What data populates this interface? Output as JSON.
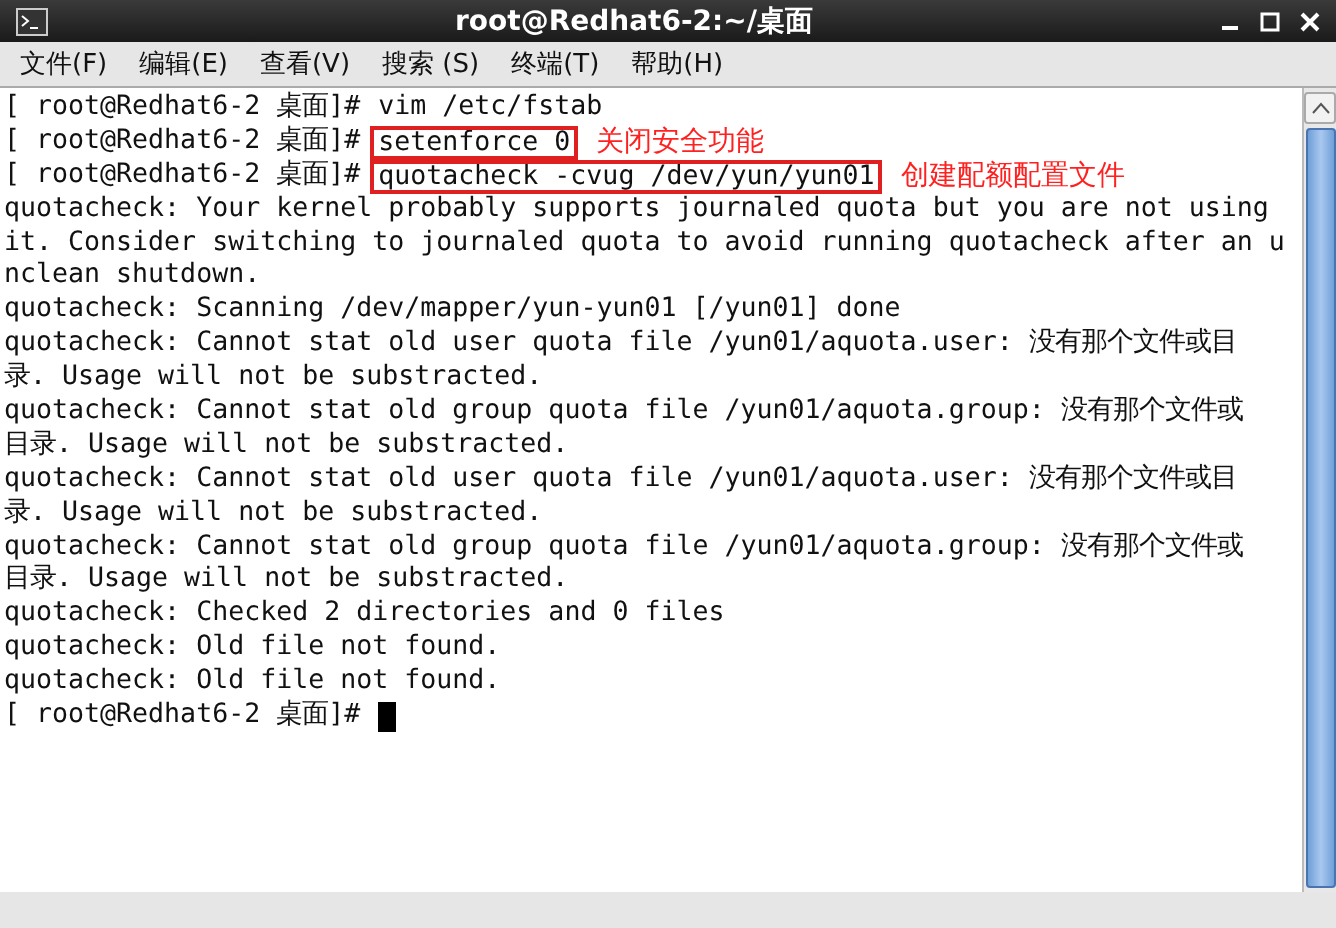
{
  "window": {
    "title": "root@Redhat6-2:~/桌面"
  },
  "menu": [
    {
      "label": "文件(F)"
    },
    {
      "label": "编辑(E)"
    },
    {
      "label": "查看(V)"
    },
    {
      "label": "搜索 (S)"
    },
    {
      "label": "终端(T)"
    },
    {
      "label": "帮助(H)"
    }
  ],
  "terminal": {
    "lines": [
      {
        "kind": "prompt",
        "prompt": "[ root@Redhat6-2 桌面]#",
        "command": "vim /etc/fstab"
      },
      {
        "kind": "prompt",
        "prompt": "[ root@Redhat6-2 桌面]#",
        "command": "setenforce 0",
        "highlighted": true,
        "annotation": "关闭安全功能"
      },
      {
        "kind": "prompt",
        "prompt": "[ root@Redhat6-2 桌面]#",
        "command": "quotacheck -cvug /dev/yun/yun01",
        "highlighted": true,
        "annotation": "创建配额配置文件"
      },
      {
        "kind": "output",
        "text": "quotacheck: Your kernel probably supports journaled quota but you are not using"
      },
      {
        "kind": "output",
        "text": "it. Consider switching to journaled quota to avoid running quotacheck after an u"
      },
      {
        "kind": "output",
        "text": "nclean shutdown."
      },
      {
        "kind": "output",
        "text": "quotacheck: Scanning /dev/mapper/yun-yun01 [/yun01] done"
      },
      {
        "kind": "output",
        "text": "quotacheck: Cannot stat old user quota file /yun01/aquota.user: 没有那个文件或目"
      },
      {
        "kind": "output",
        "text": "录. Usage will not be substracted."
      },
      {
        "kind": "output",
        "text": "quotacheck: Cannot stat old group quota file /yun01/aquota.group: 没有那个文件或"
      },
      {
        "kind": "output",
        "text": "目录. Usage will not be substracted."
      },
      {
        "kind": "output",
        "text": "quotacheck: Cannot stat old user quota file /yun01/aquota.user: 没有那个文件或目"
      },
      {
        "kind": "output",
        "text": "录. Usage will not be substracted."
      },
      {
        "kind": "output",
        "text": "quotacheck: Cannot stat old group quota file /yun01/aquota.group: 没有那个文件或"
      },
      {
        "kind": "output",
        "text": "目录. Usage will not be substracted."
      },
      {
        "kind": "output",
        "text": "quotacheck: Checked 2 directories and 0 files"
      },
      {
        "kind": "output",
        "text": "quotacheck: Old file not found."
      },
      {
        "kind": "output",
        "text": "quotacheck: Old file not found."
      },
      {
        "kind": "prompt",
        "prompt": "[ root@Redhat6-2 桌面]#",
        "cursor": true
      }
    ]
  }
}
